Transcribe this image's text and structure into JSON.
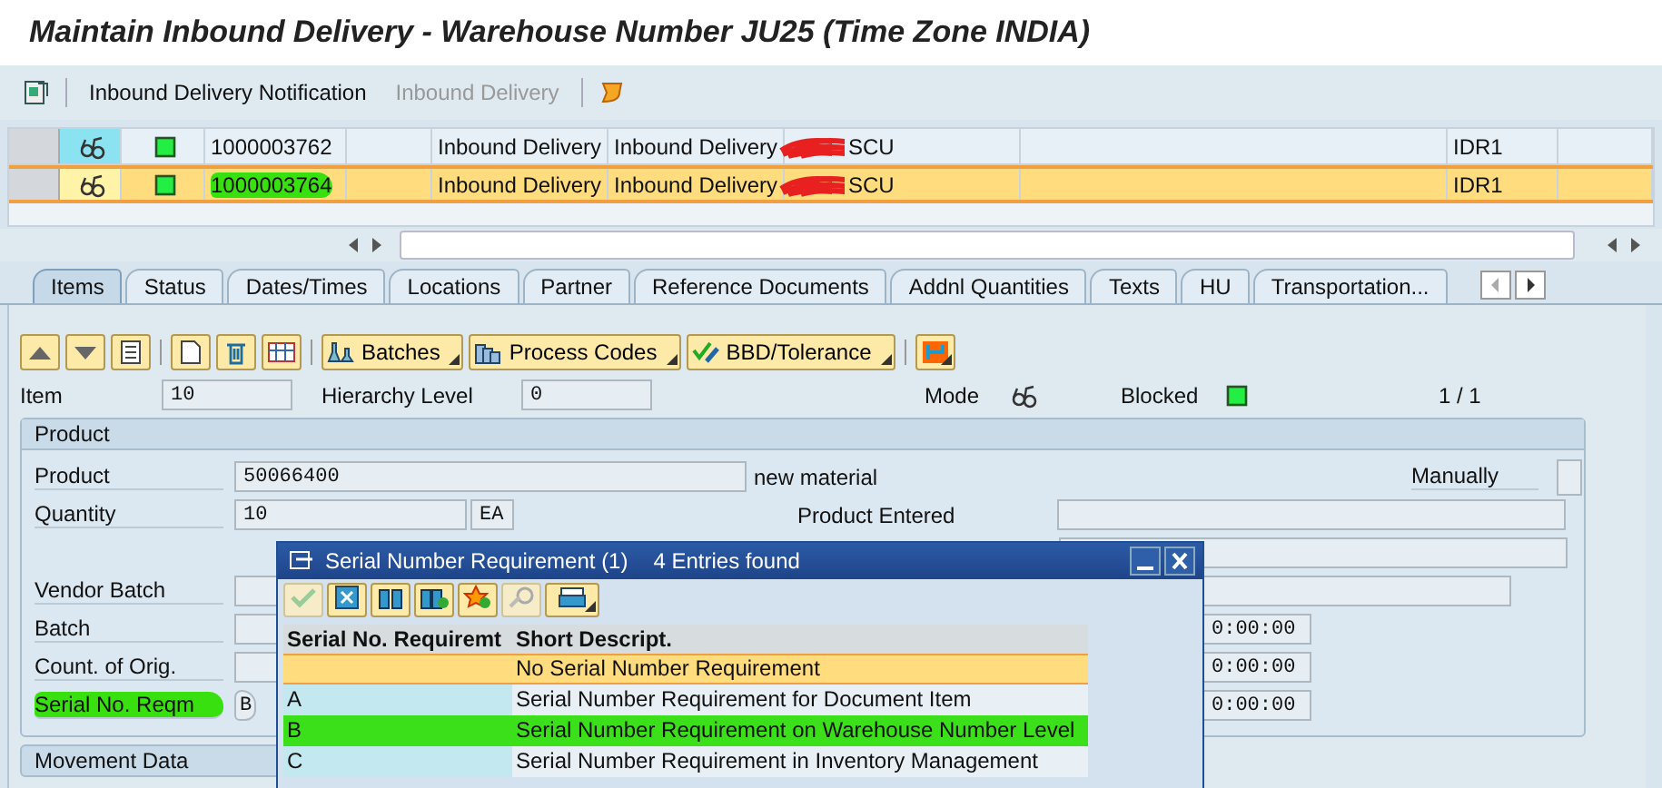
{
  "window": {
    "title": "Maintain Inbound Delivery - Warehouse Number JU25 (Time Zone INDIA)"
  },
  "toolbar": {
    "buttons": [
      {
        "label": "Inbound Delivery Notification",
        "disabled": false
      },
      {
        "label": "Inbound Delivery",
        "disabled": true
      }
    ]
  },
  "deliveries": {
    "rows": [
      {
        "selected": false,
        "number": "1000003762",
        "highlighted": false,
        "cells": [
          {
            "text": "Inbound Delivery"
          },
          {
            "text": "Inbound Delivery",
            "redacted": true
          },
          {
            "text": "SCU",
            "redacted": true
          },
          {
            "text": "IDR1"
          }
        ]
      },
      {
        "selected": true,
        "number": "1000003764",
        "highlighted": true,
        "cells": [
          {
            "text": "Inbound Delivery"
          },
          {
            "text": "Inbound Delivery",
            "redacted": true
          },
          {
            "text": "SCU",
            "redacted": true
          },
          {
            "text": "IDR1"
          }
        ]
      }
    ]
  },
  "tabs": [
    {
      "label": "Items",
      "selected": true
    },
    {
      "label": "Status",
      "selected": false
    },
    {
      "label": "Dates/Times",
      "selected": false
    },
    {
      "label": "Locations",
      "selected": false
    },
    {
      "label": "Partner",
      "selected": false
    },
    {
      "label": "Reference Documents",
      "selected": false
    },
    {
      "label": "Addnl Quantities",
      "selected": false
    },
    {
      "label": "Texts",
      "selected": false
    },
    {
      "label": "HU",
      "selected": false
    },
    {
      "label": "Transportation...",
      "selected": false
    }
  ],
  "item_toolbar": {
    "buttons": [
      "Batches",
      "Process Codes",
      "BBD/Tolerance"
    ]
  },
  "item": {
    "item_label": "Item",
    "item_value": "10",
    "hierarchy_label": "Hierarchy Level",
    "hierarchy_value": "0",
    "mode_label": "Mode",
    "blocked_label": "Blocked",
    "position": "1 / 1"
  },
  "product": {
    "title": "Product",
    "product_label": "Product",
    "product_value": "50066400",
    "product_text": "new material",
    "manually_label": "Manually",
    "manually_checked": false,
    "quantity_label": "Quantity",
    "quantity_value": "10",
    "unit": "EA",
    "entered_label": "Product Entered",
    "vendor_batch_label": "Vendor Batch",
    "batch_label": "Batch",
    "origin_label": "Count. of Orig.",
    "serial_label": "Serial No. Reqm",
    "serial_value": "B",
    "serial_highlighted": true,
    "times": [
      "0:00:00",
      "0:00:00",
      "0:00:00"
    ]
  },
  "movement": {
    "title": "Movement Data"
  },
  "dialog": {
    "title": "Serial Number Requirement (1)",
    "count": "4 Entries found",
    "columns": [
      "Serial No. Requiremt",
      "Short Descript."
    ],
    "rows": [
      {
        "description": "No Serial Number Requirement",
        "selected": true,
        "highlighted": false
      },
      {
        "code": "A",
        "description": "Serial Number Requirement for Document Item",
        "selected": false,
        "highlighted": false
      },
      {
        "code": "B",
        "description": "Serial Number Requirement on Warehouse Number Level",
        "selected": false,
        "highlighted": true
      },
      {
        "code": "C",
        "description": "Serial Number Requirement in Inventory Management",
        "selected": false,
        "highlighted": false
      }
    ]
  }
}
